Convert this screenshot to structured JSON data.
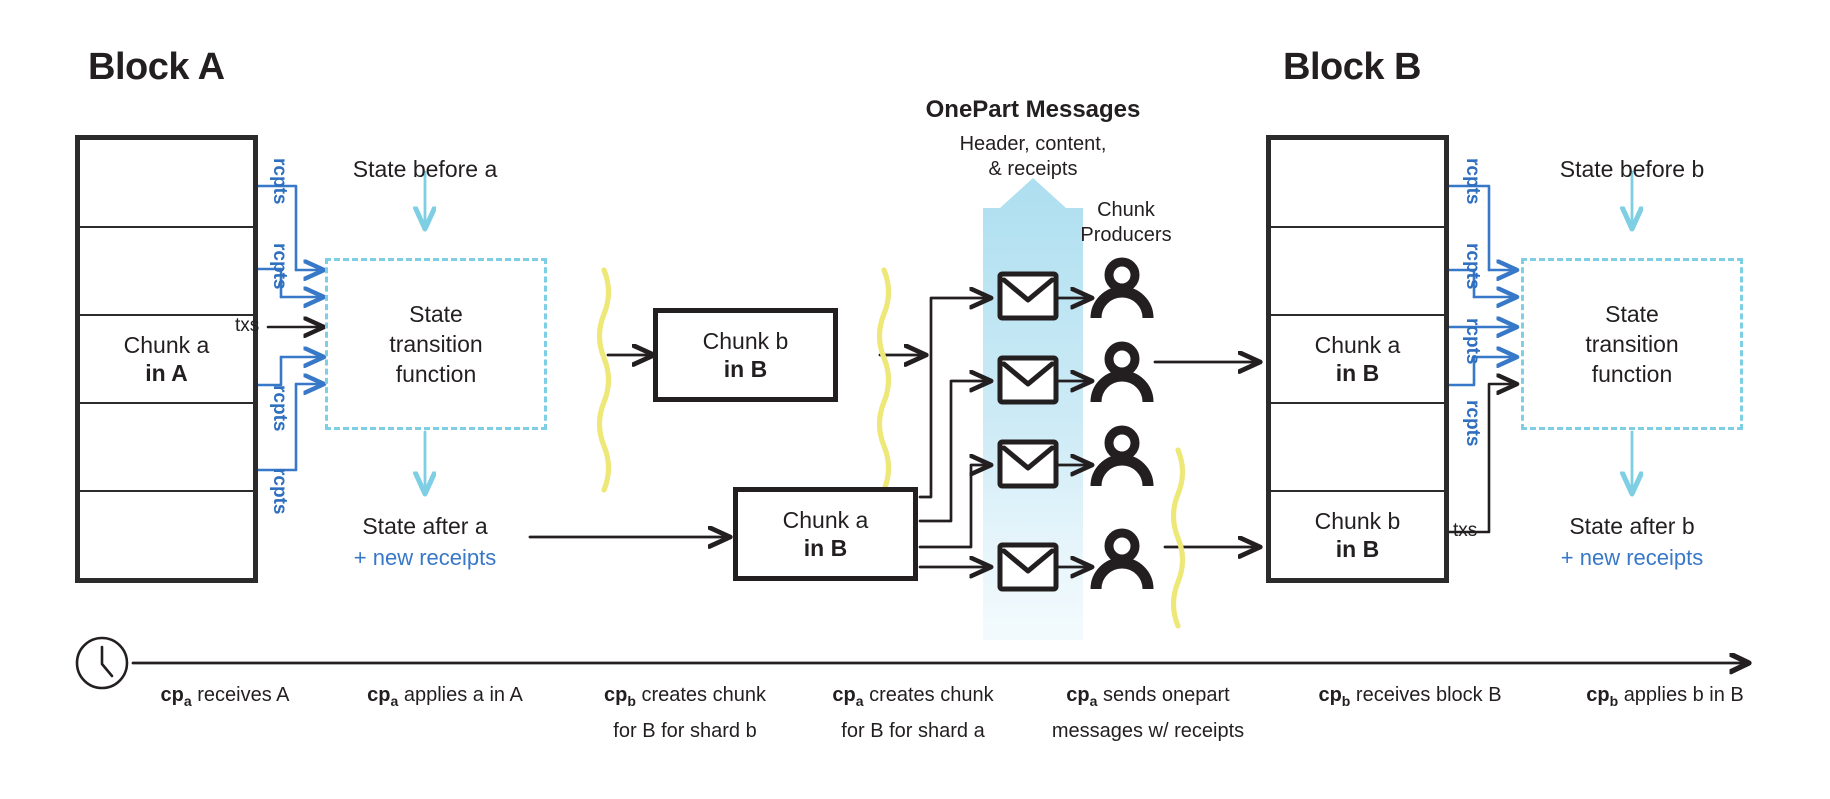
{
  "blocks": {
    "a": {
      "title": "Block A",
      "rows": [
        {
          "line1": "",
          "line2": ""
        },
        {
          "line1": "",
          "line2": ""
        },
        {
          "line1": "Chunk a",
          "line2": "in A"
        },
        {
          "line1": "",
          "line2": ""
        },
        {
          "line1": "",
          "line2": ""
        }
      ]
    },
    "b": {
      "title": "Block B",
      "rows": [
        {
          "line1": "",
          "line2": ""
        },
        {
          "line1": "",
          "line2": ""
        },
        {
          "line1": "Chunk a",
          "line2": "in B"
        },
        {
          "line1": "",
          "line2": ""
        },
        {
          "line1": "Chunk b",
          "line2": "in B"
        }
      ]
    }
  },
  "edge_labels": {
    "rcpts": "rcpts",
    "txs": "txs"
  },
  "left_pipeline": {
    "state_before": "State before a",
    "stf_line1": "State",
    "stf_line2": "transition",
    "stf_line3": "function",
    "state_after": "State after a",
    "new_receipts": "+ new receipts"
  },
  "right_pipeline": {
    "state_before": "State before b",
    "stf_line1": "State",
    "stf_line2": "transition",
    "stf_line3": "function",
    "state_after": "State after b",
    "new_receipts": "+ new receipts"
  },
  "chunk_boxes": {
    "chunk_b_in_B": {
      "line1": "Chunk b",
      "line2": "in B"
    },
    "chunk_a_in_B": {
      "line1": "Chunk a",
      "line2": "in B"
    }
  },
  "onepart": {
    "title": "OnePart Messages",
    "sub_line1": "Header, content,",
    "sub_line2": "& receipts",
    "producers_line1": "Chunk",
    "producers_line2": "Producers",
    "message_count": 4,
    "producer_count": 4
  },
  "timeline": {
    "steps": [
      {
        "prefix": "cp",
        "sub": "a",
        "line1": "receives A",
        "line2": ""
      },
      {
        "prefix": "cp",
        "sub": "a",
        "line1": "applies a in A",
        "line2": ""
      },
      {
        "prefix": "cp",
        "sub": "b",
        "line1": "creates chunk",
        "line2": "for B for shard b"
      },
      {
        "prefix": "cp",
        "sub": "a",
        "line1": "creates chunk",
        "line2": "for B for shard a"
      },
      {
        "prefix": "cp",
        "sub": "a",
        "line1": "sends onepart",
        "line2": "messages w/ receipts"
      },
      {
        "prefix": "cp",
        "sub": "b",
        "line1": "receives block B",
        "line2": ""
      },
      {
        "prefix": "cp",
        "sub": "b",
        "line1": "applies b in B",
        "line2": ""
      }
    ]
  },
  "colors": {
    "ink": "#231f20",
    "receipt_blue": "#3878c8",
    "light_blue": "#7fcfe4",
    "pale_blue": "#c3e5f2",
    "wave_yellow": "#eee878",
    "white": "#ffffff"
  },
  "icons": {
    "clock": "clock-icon",
    "envelope": "envelope-icon",
    "person": "person-icon"
  }
}
